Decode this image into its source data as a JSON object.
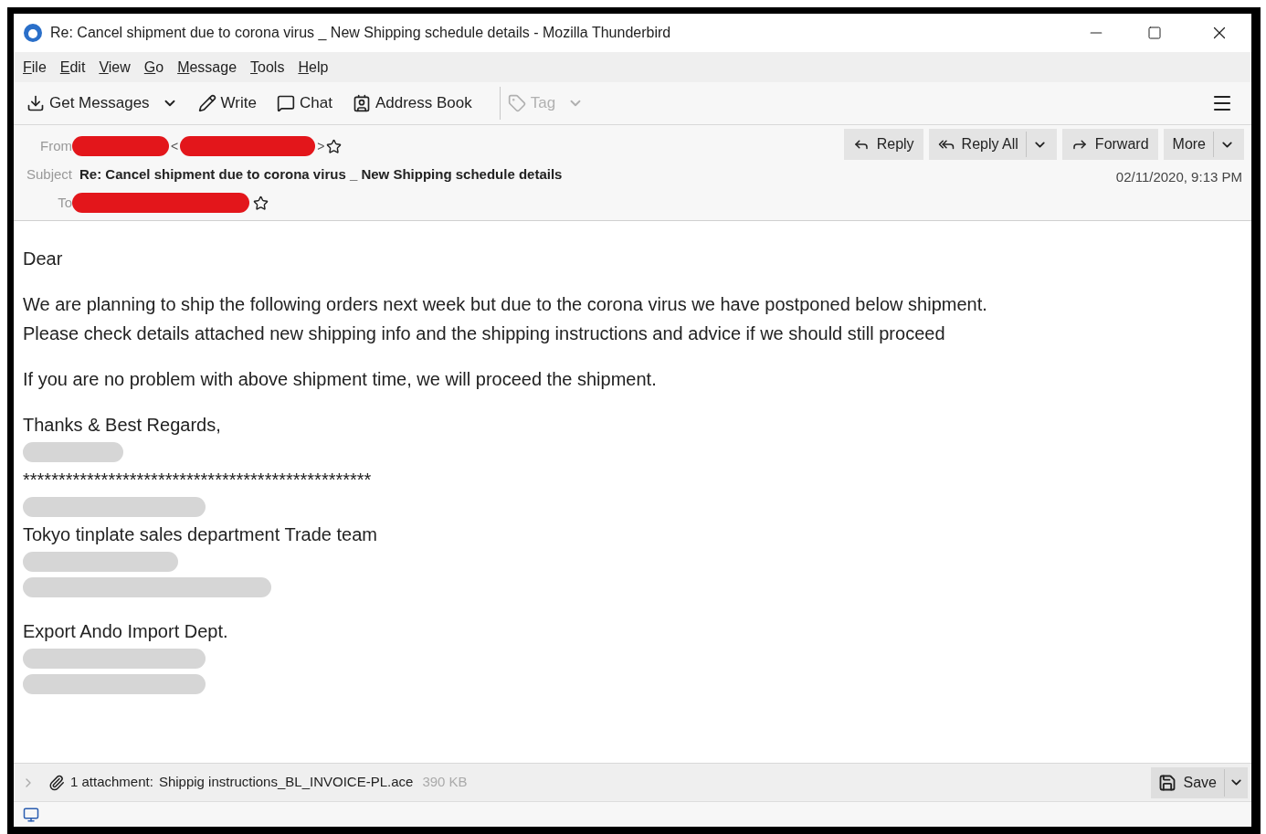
{
  "window": {
    "title": "Re: Cancel shipment due to corona virus _ New Shipping schedule details - Mozilla Thunderbird"
  },
  "menu": [
    "File",
    "Edit",
    "View",
    "Go",
    "Message",
    "Tools",
    "Help"
  ],
  "toolbar": [
    {
      "kind": "download",
      "label": "Get Messages",
      "dropdown": true,
      "disabled": false
    },
    {
      "kind": "pencil",
      "label": "Write",
      "dropdown": false,
      "disabled": false
    },
    {
      "kind": "chat",
      "label": "Chat",
      "dropdown": false,
      "disabled": false
    },
    {
      "kind": "contacts",
      "label": "Address Book",
      "dropdown": false,
      "disabled": false
    },
    {
      "kind": "tag",
      "label": "Tag",
      "dropdown": true,
      "disabled": true
    }
  ],
  "header": {
    "from_label": "From",
    "lt": "<",
    "gt": ">",
    "subject_label": "Subject",
    "subject": "Re: Cancel shipment due to corona virus _ New Shipping schedule details",
    "to_label": "To",
    "date": "02/11/2020, 9:13 PM",
    "actions": [
      {
        "kind": "reply",
        "label": "Reply",
        "dropdown": false
      },
      {
        "kind": "reply-all",
        "label": "Reply All",
        "dropdown": true
      },
      {
        "kind": "forward",
        "label": "Forward",
        "dropdown": false
      },
      {
        "kind": "more",
        "label": "More",
        "dropdown": true
      }
    ]
  },
  "body": [
    [
      {
        "kind": "text",
        "text": "Dear"
      }
    ],
    [
      {
        "kind": "text",
        "text": "We are planning to ship the following orders next week but due to the corona virus we have postponed below shipment."
      },
      {
        "kind": "text",
        "text": "Please check details attached new shipping info and the shipping instructions and advice if we should still proceed"
      }
    ],
    [
      {
        "kind": "text",
        "text": "If you are no problem with above shipment time, we will proceed the shipment."
      }
    ],
    [
      {
        "kind": "text",
        "text": "Thanks & Best Regards,"
      },
      {
        "kind": "redacted"
      },
      {
        "kind": "text",
        "text": "*************************************************"
      },
      {
        "kind": "redacted"
      },
      {
        "kind": "text",
        "text": "Tokyo tinplate sales department Trade team"
      },
      {
        "kind": "redacted"
      },
      {
        "kind": "redacted"
      }
    ],
    [
      {
        "kind": "text",
        "text": "Export Ando Import Dept."
      },
      {
        "kind": "redacted"
      },
      {
        "kind": "redacted"
      }
    ]
  ],
  "attachment": {
    "label": "1 attachment:",
    "name": "Shippig instructions_BL_INVOICE-PL.ace",
    "size": "390 KB",
    "expanded": false,
    "save": "Save"
  }
}
